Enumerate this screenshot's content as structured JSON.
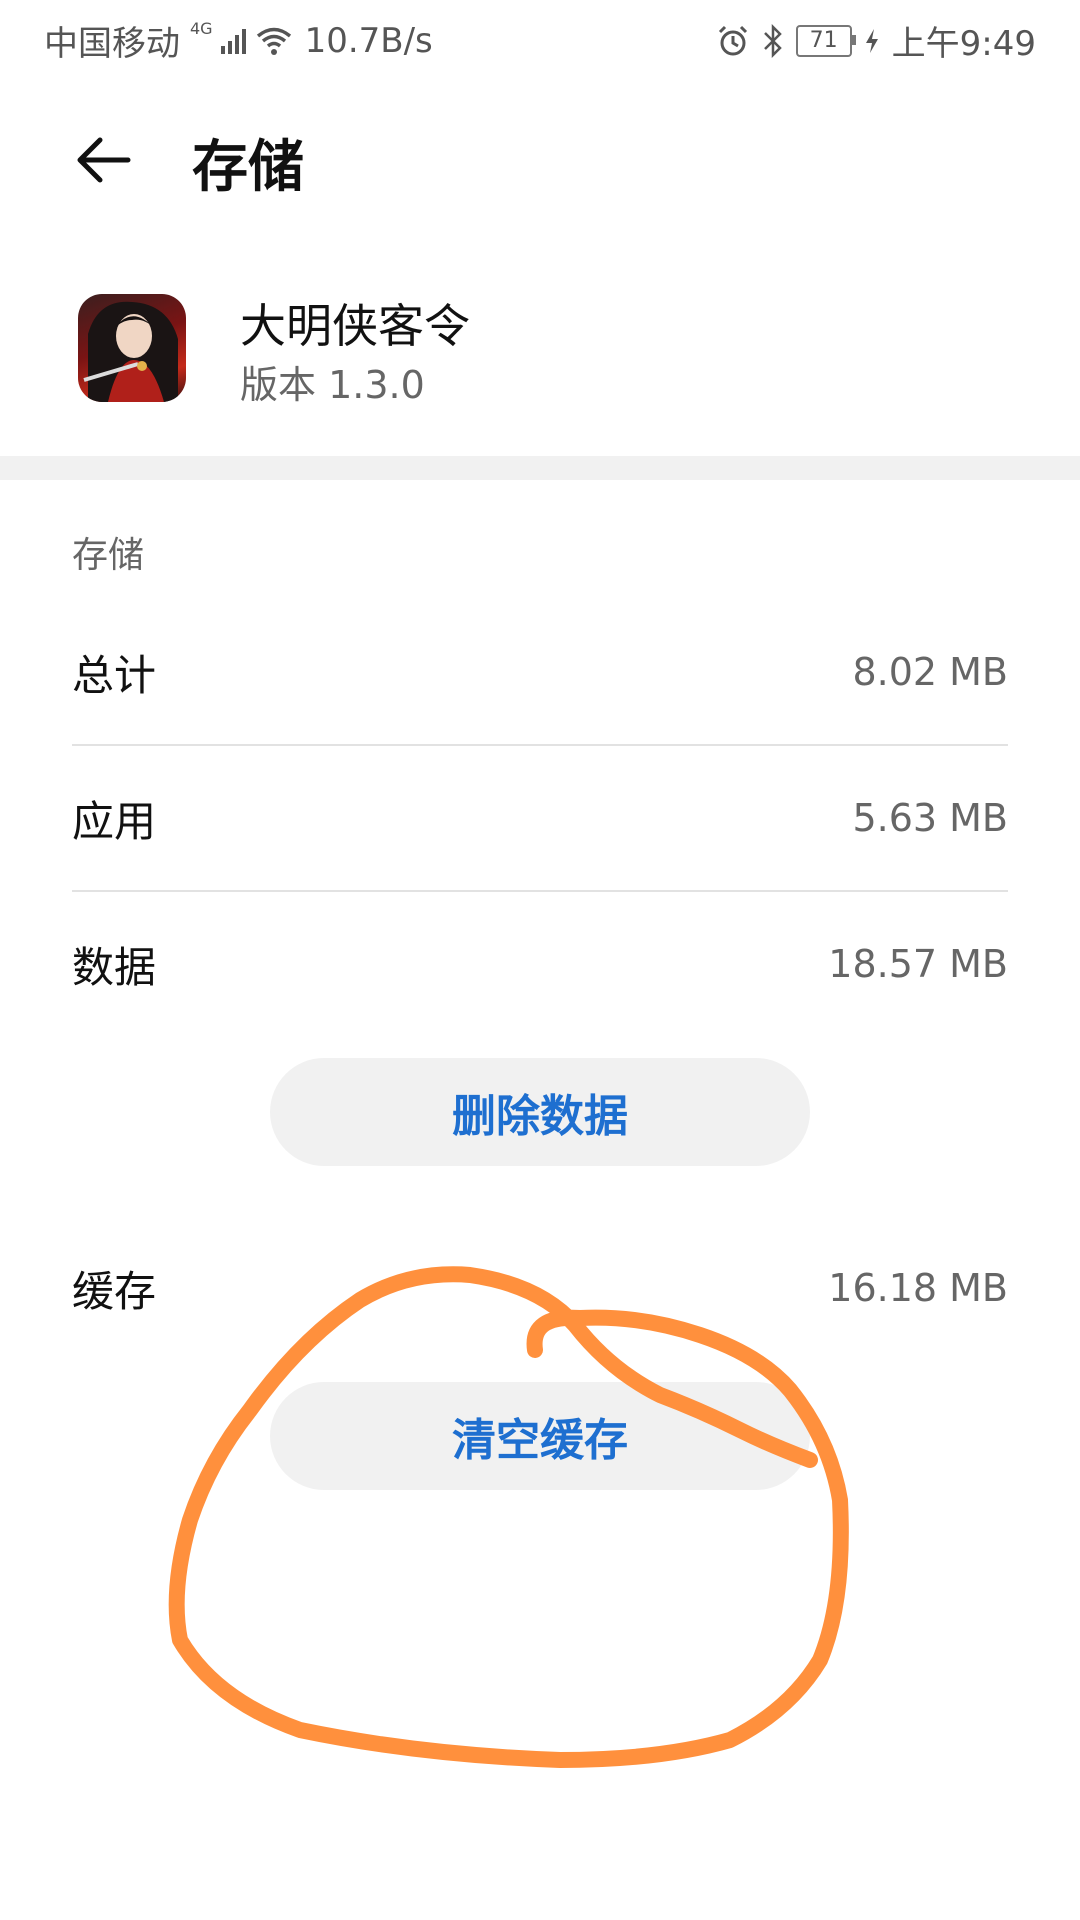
{
  "status_bar": {
    "carrier": "中国移动",
    "network_type": "4G",
    "speed": "10.7B/s",
    "battery": "71",
    "time": "上午9:49"
  },
  "header": {
    "title": "存储"
  },
  "app": {
    "name": "大明侠客令",
    "version": "版本 1.3.0"
  },
  "storage": {
    "section_label": "存储",
    "total": {
      "label": "总计",
      "value": "8.02 MB"
    },
    "app": {
      "label": "应用",
      "value": "5.63 MB"
    },
    "data": {
      "label": "数据",
      "value": "18.57 MB"
    },
    "delete_button": "删除数据",
    "cache": {
      "label": "缓存",
      "value": "16.18 MB"
    },
    "clear_cache_button": "清空缓存"
  },
  "colors": {
    "accent": "#1e6fd0",
    "annotation": "#ff8a33",
    "band": "#f1f1f1"
  }
}
